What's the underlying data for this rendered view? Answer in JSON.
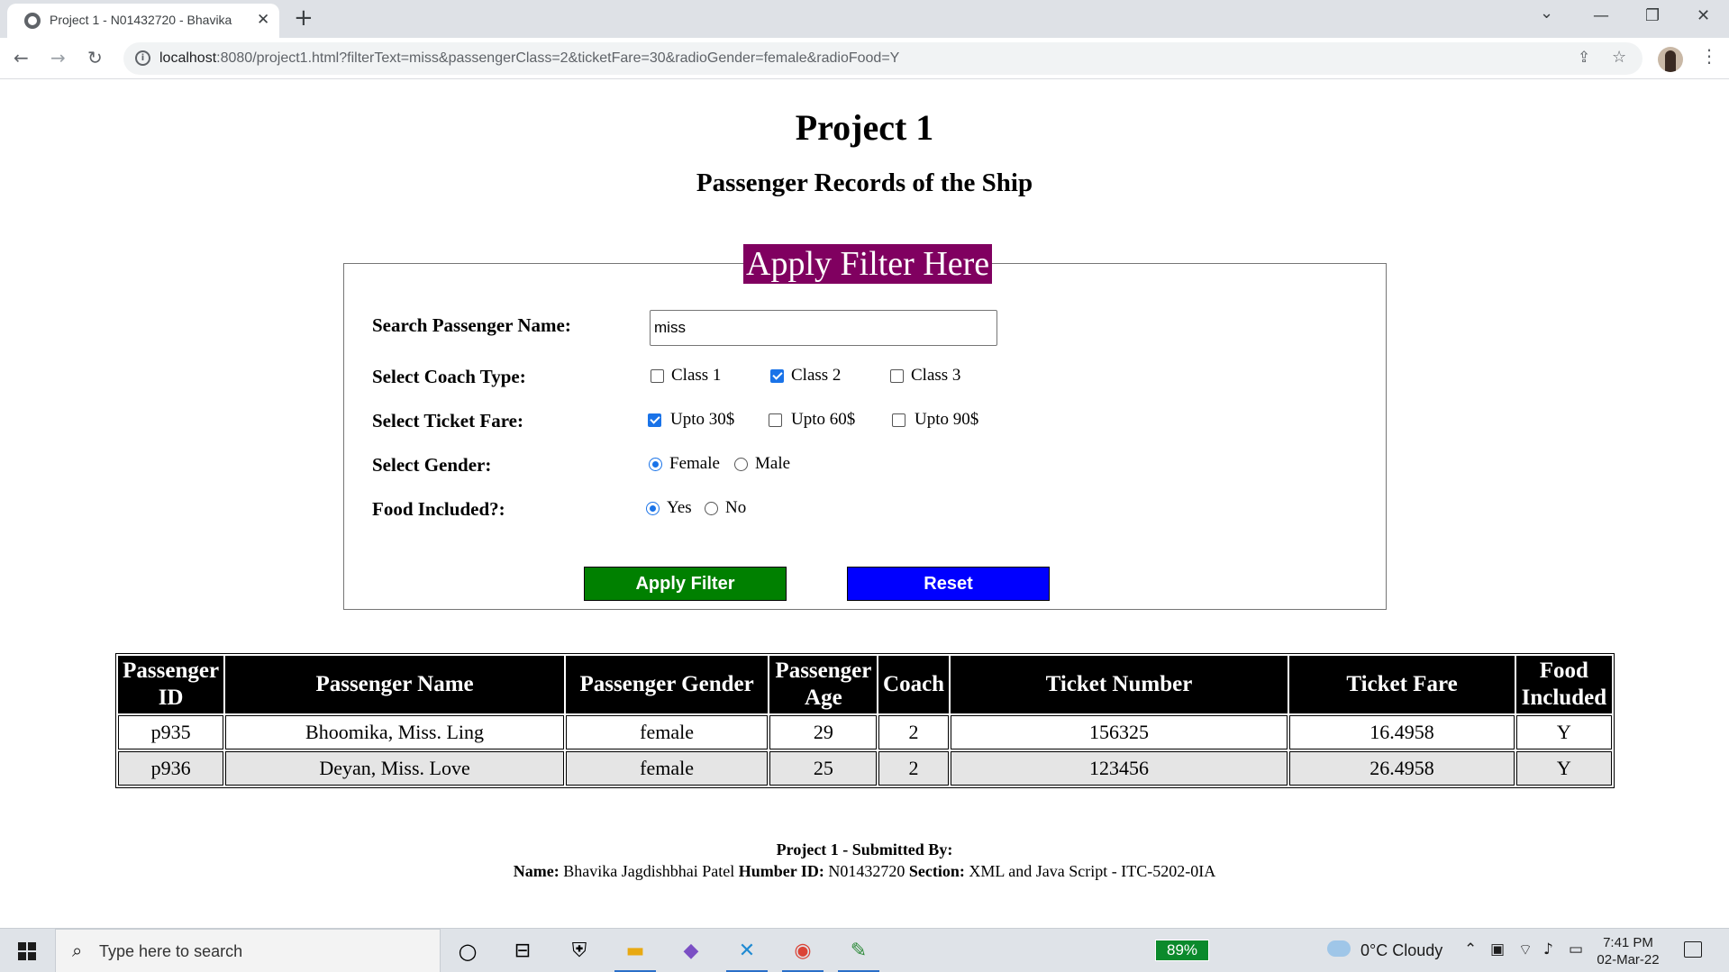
{
  "browser": {
    "tab_title": "Project 1 - N01432720 - Bhavika",
    "tab_close": "✕",
    "new_tab": "+",
    "url_host": "localhost",
    "url_rest": ":8080/project1.html?filterText=miss&passengerClass=2&ticketFare=30&radioGender=female&radioFood=Y",
    "back": "←",
    "forward": "→",
    "reload": "↻",
    "menu": "⋮",
    "minimize": "—",
    "restore": "❐",
    "close": "✕",
    "tab_list": "⌄"
  },
  "page": {
    "title": "Project 1",
    "subtitle": "Passenger Records of the Ship"
  },
  "filter": {
    "legend": "Apply Filter Here",
    "name_label": "Search Passenger Name:",
    "name_value": "miss",
    "coach_label": "Select Coach Type:",
    "coach_options": [
      {
        "label": "Class 1",
        "checked": false
      },
      {
        "label": "Class 2",
        "checked": true
      },
      {
        "label": "Class 3",
        "checked": false
      }
    ],
    "fare_label": "Select Ticket Fare:",
    "fare_options": [
      {
        "label": "Upto 30$",
        "checked": true
      },
      {
        "label": "Upto 60$",
        "checked": false
      },
      {
        "label": "Upto 90$",
        "checked": false
      }
    ],
    "gender_label": "Select Gender:",
    "gender_options": [
      {
        "label": "Female",
        "checked": true
      },
      {
        "label": "Male",
        "checked": false
      }
    ],
    "food_label": "Food Included?:",
    "food_options": [
      {
        "label": "Yes",
        "checked": true
      },
      {
        "label": "No",
        "checked": false
      }
    ],
    "apply_button": "Apply Filter",
    "reset_button": "Reset"
  },
  "table": {
    "headers": [
      "Passenger ID",
      "Passenger Name",
      "Passenger Gender",
      "Passenger Age",
      "Coach",
      "Ticket Number",
      "Ticket Fare",
      "Food Included"
    ],
    "rows": [
      [
        "p935",
        "Bhoomika, Miss. Ling",
        "female",
        "29",
        "2",
        "156325",
        "16.4958",
        "Y"
      ],
      [
        "p936",
        "Deyan, Miss. Love",
        "female",
        "25",
        "2",
        "123456",
        "26.4958",
        "Y"
      ]
    ]
  },
  "footer": {
    "line1": "Project 1 - Submitted By:",
    "name_label": "Name:",
    "name_value": "Bhavika Jagdishbhai Patel",
    "id_label": "Humber ID:",
    "id_value": "N01432720",
    "section_label": "Section:",
    "section_value": "XML and Java Script - ITC-5202-0IA"
  },
  "taskbar": {
    "search_placeholder": "Type here to search",
    "battery": "89%",
    "weather": "0°C  Cloudy",
    "time": "7:41 PM",
    "date": "02-Mar-22"
  },
  "colors": {
    "legend_bg": "#800060",
    "apply_bg": "#008000",
    "reset_bg": "#0000ff",
    "header_bg": "#000000",
    "alt_row_bg": "#e5e5e5"
  }
}
